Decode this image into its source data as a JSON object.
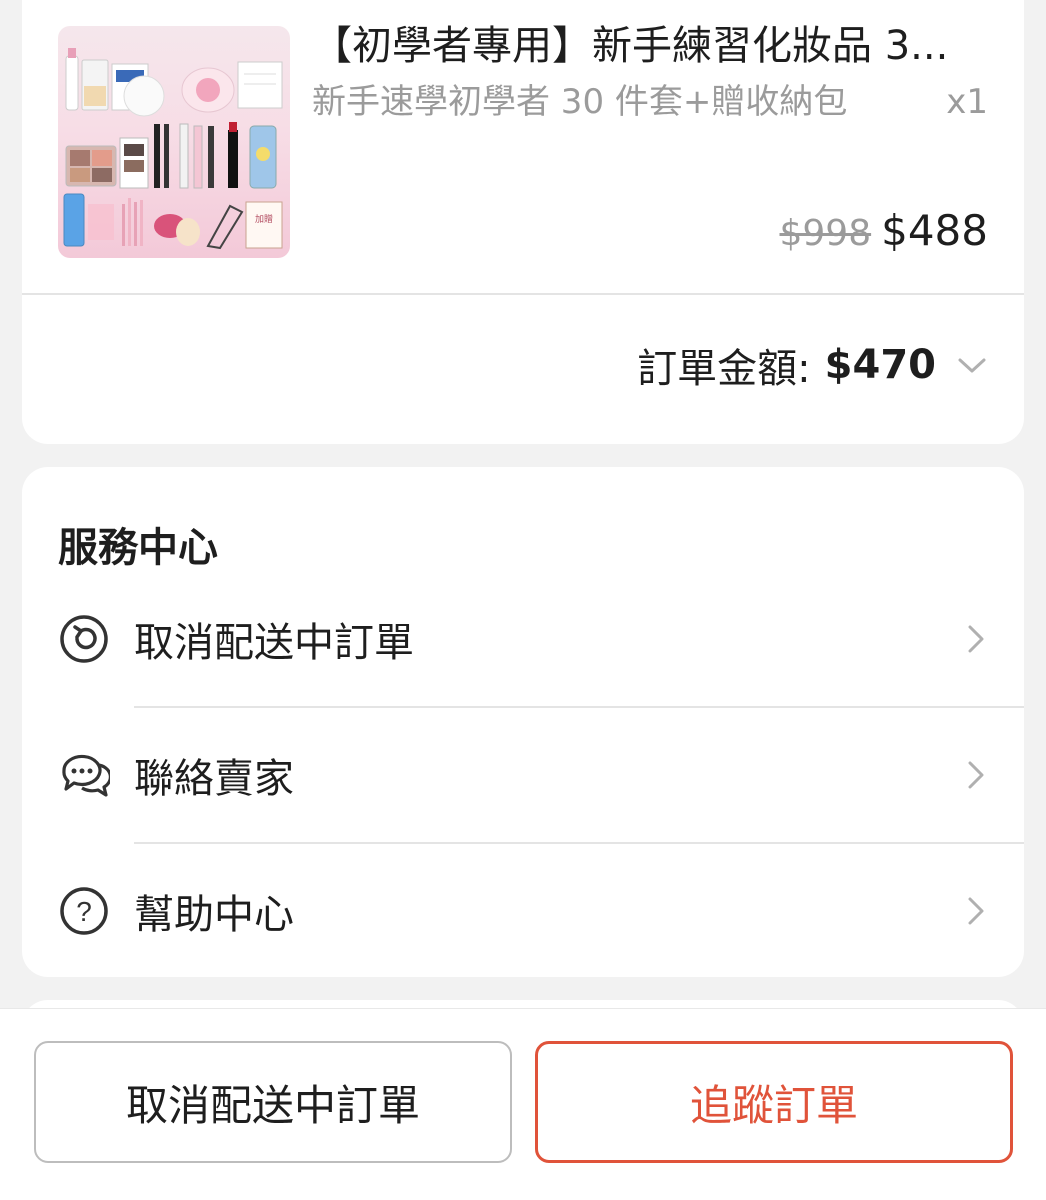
{
  "order": {
    "product": {
      "title": "【初學者專用】新手練習化妝品 3...",
      "variant": "新手速學初學者 30 件套+贈收納包",
      "quantity": "x1",
      "original_price": "$998",
      "price": "$488"
    },
    "total_label": "訂單金額:",
    "total_value": "$470"
  },
  "service_center": {
    "title": "服務中心",
    "items": [
      {
        "label": "取消配送中訂單",
        "icon": "undo-icon"
      },
      {
        "label": "聯絡賣家",
        "icon": "chat-bubbles-icon"
      },
      {
        "label": "幫助中心",
        "icon": "help-circle-icon"
      }
    ]
  },
  "bottom_bar": {
    "secondary_button": "取消配送中訂單",
    "primary_button": "追蹤訂單"
  },
  "colors": {
    "accent": "#e0533a",
    "divider": "#e4e4e4",
    "muted_text": "#9b9b9b",
    "background": "#f2f2f2"
  }
}
